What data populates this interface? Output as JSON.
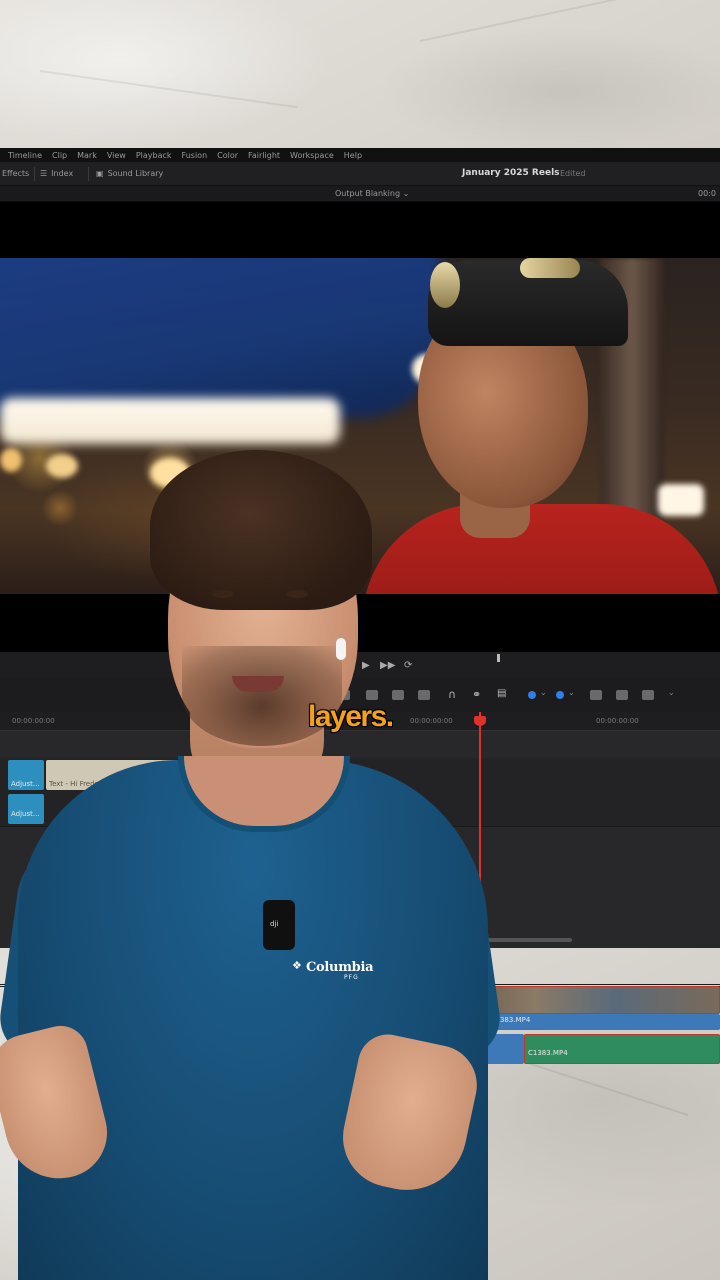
{
  "app": {
    "menu": [
      "Timeline",
      "Clip",
      "Mark",
      "View",
      "Playback",
      "Fusion",
      "Color",
      "Fairlight",
      "Workspace",
      "Help"
    ],
    "toolbar": {
      "effects_label": "Effects",
      "index_label": "Index",
      "sound_library_label": "Sound Library"
    },
    "project_title": "January 2025 Reels",
    "project_state": "Edited",
    "viewer_title": "Output Blanking",
    "viewer_timecode": "00:0",
    "timeline": {
      "ruler_timecodes": [
        "00:00:00:00",
        "00:00:00:00",
        "00:00:00:00"
      ],
      "clips": {
        "adjustment_1": "Adjust...",
        "text_clip": "Text - Hi Freds",
        "adjustment_2": "Adjust...",
        "video_clip": "C1383.MP4",
        "audio_clip": "C1383.MP4"
      }
    }
  },
  "overlay": {
    "caption": "layers.",
    "caption_color": "#f5a21b",
    "shirt_brand": "Columbia",
    "shirt_brand_sub": "PFG",
    "mic_label": "dji"
  },
  "icons": [
    "play-icon",
    "stop-icon",
    "next-icon",
    "loop-icon",
    "snap-icon",
    "link-icon",
    "lock-icon"
  ]
}
